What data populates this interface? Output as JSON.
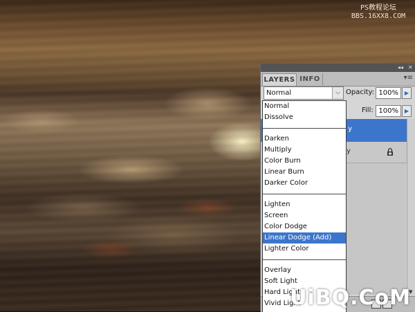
{
  "watermark_top": {
    "line1": "PS教程论坛",
    "line2": "BBS.16XX8.COM"
  },
  "watermark_bottom": "UiBQ.CoM",
  "panel": {
    "tabs": [
      {
        "label": "LAYERS"
      },
      {
        "label": "INFO"
      }
    ],
    "blend_mode": "Normal",
    "opacity_label": "Opacity:",
    "opacity_value": "100%",
    "fill_label": "Fill:",
    "fill_value": "100%",
    "selected_layer_name_fragment": "y"
  },
  "dropdown": {
    "groups": [
      [
        "Normal",
        "Dissolve"
      ],
      [
        "Darken",
        "Multiply",
        "Color Burn",
        "Linear Burn",
        "Darker Color"
      ],
      [
        "Lighten",
        "Screen",
        "Color Dodge",
        "Linear Dodge (Add)",
        "Lighter Color"
      ],
      [
        "Overlay",
        "Soft Light",
        "Hard Light",
        "Vivid Light"
      ]
    ],
    "selected": "Linear Dodge (Add)"
  },
  "colors": {
    "highlight": "#3c76cc",
    "panel_bg": "#d6d6d6",
    "panel_topbar": "#535353"
  },
  "icons": [
    "collapse-icon",
    "close-icon",
    "panel-menu-icon",
    "dropdown-arrow-icon",
    "stepper-arrow-icon",
    "lock-icon"
  ]
}
